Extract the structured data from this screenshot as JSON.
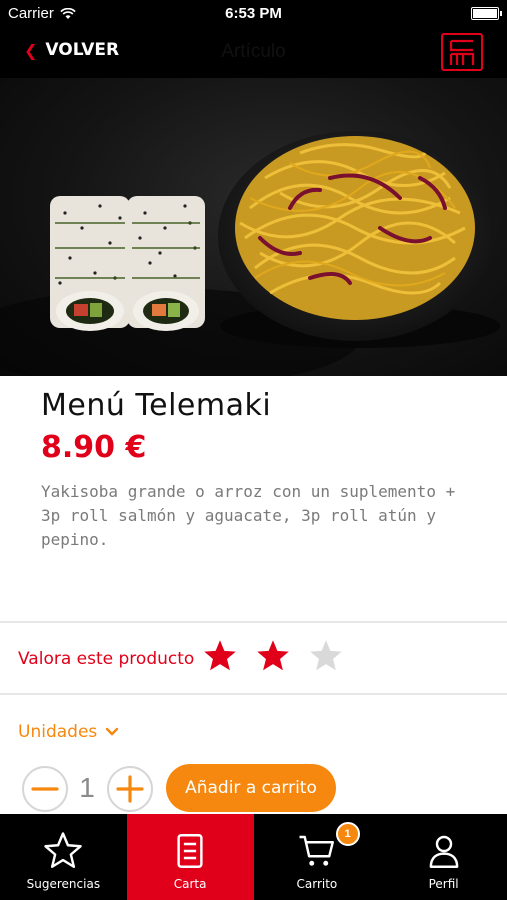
{
  "status_bar": {
    "carrier": "Carrier",
    "time": "6:53 PM"
  },
  "nav": {
    "back_label": "VOLVER",
    "title": "Artículo"
  },
  "product": {
    "name": "Menú Telemaki",
    "price": "8.90 €",
    "description": "Yakisoba grande o arroz con un suplemento + 3p roll salmón y aguacate, 3p roll atún y pepino."
  },
  "rating": {
    "label": "Valora este producto",
    "value": 2,
    "max": 3
  },
  "units": {
    "label": "Unidades",
    "quantity": "1"
  },
  "cart": {
    "add_label": "Añadir a carrito"
  },
  "tabs": [
    {
      "label": "Sugerencias",
      "icon": "star-icon",
      "active": false
    },
    {
      "label": "Carta",
      "icon": "menu-icon",
      "active": true
    },
    {
      "label": "Carrito",
      "icon": "cart-icon",
      "active": false,
      "badge": "1"
    },
    {
      "label": "Perfil",
      "icon": "user-icon",
      "active": false
    }
  ],
  "colors": {
    "accent": "#e1001a",
    "secondary": "#f7880f",
    "bar": "#000000"
  }
}
